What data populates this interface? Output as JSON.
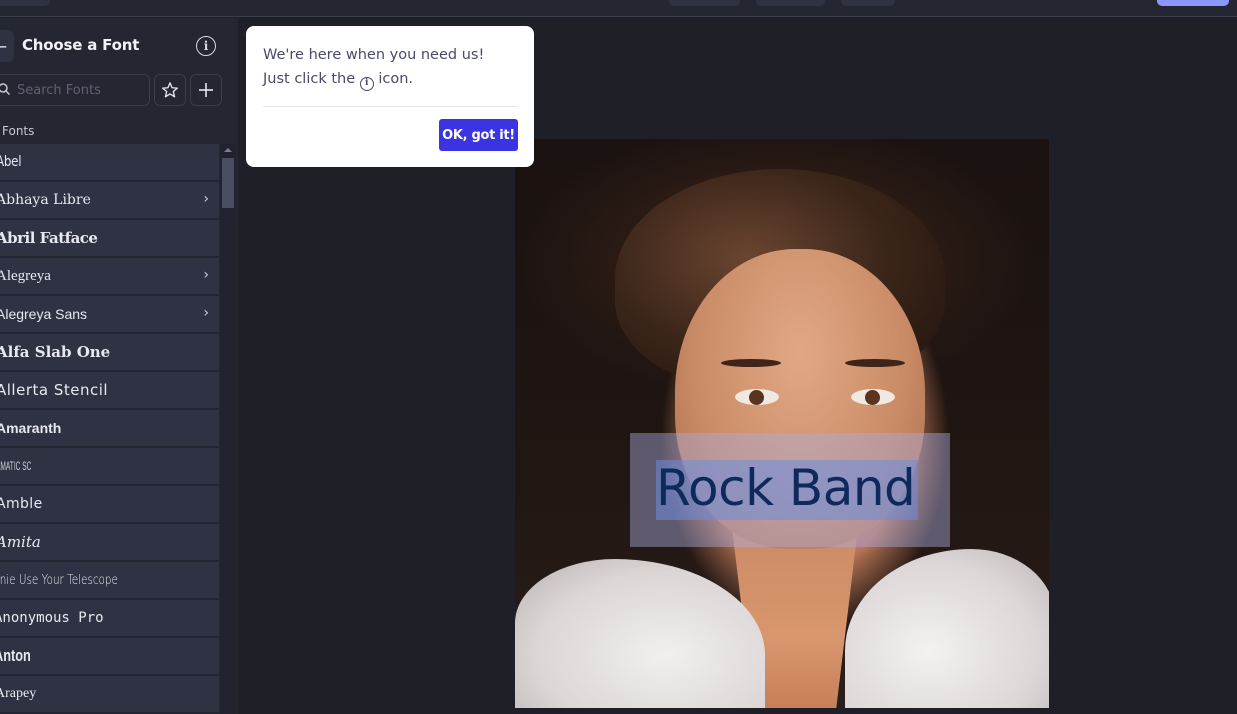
{
  "topbar": {
    "buttons": [
      "",
      "",
      "",
      ""
    ],
    "primary_button_color": "#8c97ff"
  },
  "sidebar": {
    "back_icon": "minus",
    "title": "Choose a Font",
    "info_icon": "i",
    "search": {
      "placeholder": "Search Fonts",
      "value": ""
    },
    "favorites_icon": "star",
    "add_icon": "+",
    "section_label": "Fonts",
    "fonts": [
      {
        "name": "Abel",
        "has_variants": false
      },
      {
        "name": "Abhaya Libre",
        "has_variants": true
      },
      {
        "name": "Abril Fatface",
        "has_variants": false
      },
      {
        "name": "Alegreya",
        "has_variants": true
      },
      {
        "name": "Alegreya Sans",
        "has_variants": true
      },
      {
        "name": "Alfa Slab One",
        "has_variants": false
      },
      {
        "name": "Allerta Stencil",
        "has_variants": false
      },
      {
        "name": "Amaranth",
        "has_variants": false
      },
      {
        "name": "AMATIC SC",
        "has_variants": false
      },
      {
        "name": "Amble",
        "has_variants": false
      },
      {
        "name": "Amita",
        "has_variants": false
      },
      {
        "name": "Annie Use Your Telescope",
        "has_variants": false
      },
      {
        "name": "Anonymous Pro",
        "has_variants": false
      },
      {
        "name": "Anton",
        "has_variants": false
      },
      {
        "name": "Arapey",
        "has_variants": false
      }
    ],
    "chevron": "›"
  },
  "canvas": {
    "text_layer": "Rock Band",
    "text_color": "#0d2a5a"
  },
  "popup": {
    "line1": "We're here when you need us!",
    "line2_prefix": "Just click the",
    "line2_icon": "i",
    "line2_suffix": "icon.",
    "ok_button": "OK, got it!",
    "button_color": "#3a35e0"
  }
}
